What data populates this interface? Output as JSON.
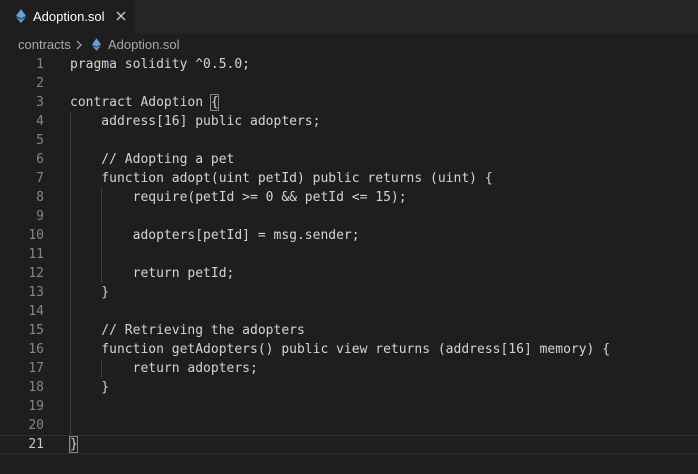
{
  "tab": {
    "label": "Adoption.sol",
    "close_icon": "close-icon",
    "file_icon": "ethereum-icon"
  },
  "breadcrumb": {
    "folder": "contracts",
    "file": "Adoption.sol"
  },
  "editor": {
    "lines": [
      {
        "num": "1",
        "text": "pragma solidity ^0.5.0;"
      },
      {
        "num": "2",
        "text": ""
      },
      {
        "num": "3",
        "text": "contract Adoption {"
      },
      {
        "num": "4",
        "text": "    address[16] public adopters;"
      },
      {
        "num": "5",
        "text": ""
      },
      {
        "num": "6",
        "text": "    // Adopting a pet"
      },
      {
        "num": "7",
        "text": "    function adopt(uint petId) public returns (uint) {"
      },
      {
        "num": "8",
        "text": "        require(petId >= 0 && petId <= 15);"
      },
      {
        "num": "9",
        "text": ""
      },
      {
        "num": "10",
        "text": "        adopters[petId] = msg.sender;"
      },
      {
        "num": "11",
        "text": ""
      },
      {
        "num": "12",
        "text": "        return petId;"
      },
      {
        "num": "13",
        "text": "    }"
      },
      {
        "num": "14",
        "text": ""
      },
      {
        "num": "15",
        "text": "    // Retrieving the adopters"
      },
      {
        "num": "16",
        "text": "    function getAdopters() public view returns (address[16] memory) {"
      },
      {
        "num": "17",
        "text": "        return adopters;"
      },
      {
        "num": "18",
        "text": "    }"
      },
      {
        "num": "19",
        "text": ""
      },
      {
        "num": "20",
        "text": ""
      },
      {
        "num": "21",
        "text": "}"
      }
    ],
    "current_line": "21"
  }
}
